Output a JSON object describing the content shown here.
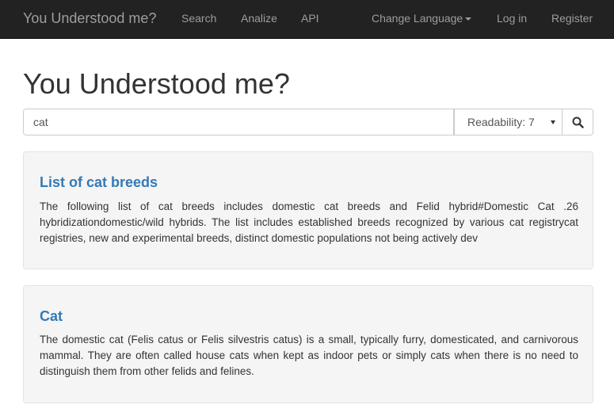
{
  "navbar": {
    "brand": "You Understood me?",
    "links": [
      "Search",
      "Analize",
      "API"
    ],
    "change_language": "Change Language",
    "login": "Log in",
    "register": "Register"
  },
  "page": {
    "title": "You Understood me?"
  },
  "search": {
    "query": "cat",
    "readability_selected": "Readability: 7"
  },
  "results": [
    {
      "title": "List of cat breeds",
      "snippet": "The following list of cat breeds includes domestic cat breeds and Felid hybrid#Domestic Cat .26 hybridizationdomestic/wild hybrids. The list includes established breeds recognized by various cat registrycat registries, new and experimental breeds, distinct domestic populations not being actively dev"
    },
    {
      "title": "Cat",
      "snippet": "The domestic cat (Felis catus or Felis silvestris catus) is a small, typically furry, domesticated, and carnivorous mammal. They are often called house cats when kept as indoor pets or simply cats when there is no need to distinguish them from other felids and felines."
    }
  ],
  "colors": {
    "navbar_bg": "#222222",
    "navbar_text": "#9d9d9d",
    "link": "#337ab7",
    "well_bg": "#f5f5f5"
  }
}
